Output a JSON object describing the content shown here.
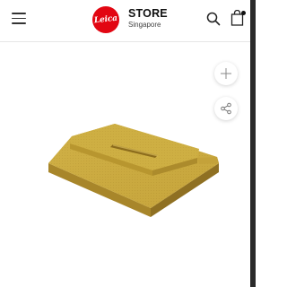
{
  "header": {
    "brand_logo_text": "Leica",
    "title": "STORE",
    "subtitle": "Singapore",
    "icons": {
      "menu": "hamburger-menu-icon",
      "search": "search-icon",
      "cart": "shopping-bag-icon"
    }
  },
  "product": {
    "image": "gold-hot-shoe-cover",
    "color": "#c9a93f"
  },
  "actions": {
    "zoom_icon": "plus-icon",
    "share_icon": "share-icon"
  },
  "colors": {
    "brand_red": "#e20612",
    "text": "#111111"
  }
}
